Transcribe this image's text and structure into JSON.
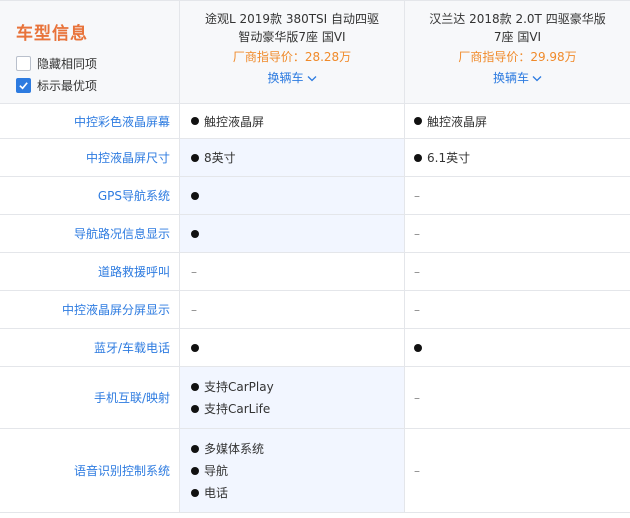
{
  "header": {
    "title": "车型信息",
    "options": [
      {
        "label": "隐藏相同项",
        "checked": false
      },
      {
        "label": "标示最优项",
        "checked": true
      }
    ],
    "cars": [
      {
        "name_line1": "途观L 2019款 380TSI 自动四驱",
        "name_line2": "智动豪华版7座 国VI",
        "price": "厂商指导价：28.28万",
        "swap": "换辆车"
      },
      {
        "name_line1": "汉兰达 2018款 2.0T 四驱豪华版",
        "name_line2": "7座 国VI",
        "price": "厂商指导价：29.98万",
        "swap": "换辆车"
      }
    ]
  },
  "rows": [
    {
      "label": "中控彩色液晶屏幕",
      "c1": {
        "items": [
          {
            "dot": true,
            "text": "触控液晶屏"
          }
        ]
      },
      "c2": {
        "items": [
          {
            "dot": true,
            "text": "触控液晶屏"
          }
        ]
      }
    },
    {
      "label": "中控液晶屏尺寸",
      "c1": {
        "items": [
          {
            "dot": true,
            "text": "8英寸"
          }
        ],
        "hl": true
      },
      "c2": {
        "items": [
          {
            "dot": true,
            "text": "6.1英寸"
          }
        ]
      }
    },
    {
      "label": "GPS导航系统",
      "c1": {
        "items": [
          {
            "dot": true,
            "text": ""
          }
        ],
        "hl": true
      },
      "c2": {
        "items": [
          {
            "dot": false,
            "text": "–"
          }
        ]
      }
    },
    {
      "label": "导航路况信息显示",
      "c1": {
        "items": [
          {
            "dot": true,
            "text": ""
          }
        ],
        "hl": true
      },
      "c2": {
        "items": [
          {
            "dot": false,
            "text": "–"
          }
        ]
      }
    },
    {
      "label": "道路救援呼叫",
      "c1": {
        "items": [
          {
            "dot": false,
            "text": "–"
          }
        ]
      },
      "c2": {
        "items": [
          {
            "dot": false,
            "text": "–"
          }
        ]
      }
    },
    {
      "label": "中控液晶屏分屏显示",
      "c1": {
        "items": [
          {
            "dot": false,
            "text": "–"
          }
        ]
      },
      "c2": {
        "items": [
          {
            "dot": false,
            "text": "–"
          }
        ]
      }
    },
    {
      "label": "蓝牙/车载电话",
      "c1": {
        "items": [
          {
            "dot": true,
            "text": ""
          }
        ]
      },
      "c2": {
        "items": [
          {
            "dot": true,
            "text": ""
          }
        ]
      }
    },
    {
      "label": "手机互联/映射",
      "c1": {
        "items": [
          {
            "dot": true,
            "text": "支持CarPlay"
          },
          {
            "dot": true,
            "text": "支持CarLife"
          }
        ],
        "hl": true
      },
      "c2": {
        "items": [
          {
            "dot": false,
            "text": "–"
          }
        ]
      }
    },
    {
      "label": "语音识别控制系统",
      "c1": {
        "items": [
          {
            "dot": true,
            "text": "多媒体系统"
          },
          {
            "dot": true,
            "text": "导航"
          },
          {
            "dot": true,
            "text": "电话"
          }
        ],
        "hl": true
      },
      "c2": {
        "items": [
          {
            "dot": false,
            "text": "–"
          }
        ]
      }
    }
  ]
}
